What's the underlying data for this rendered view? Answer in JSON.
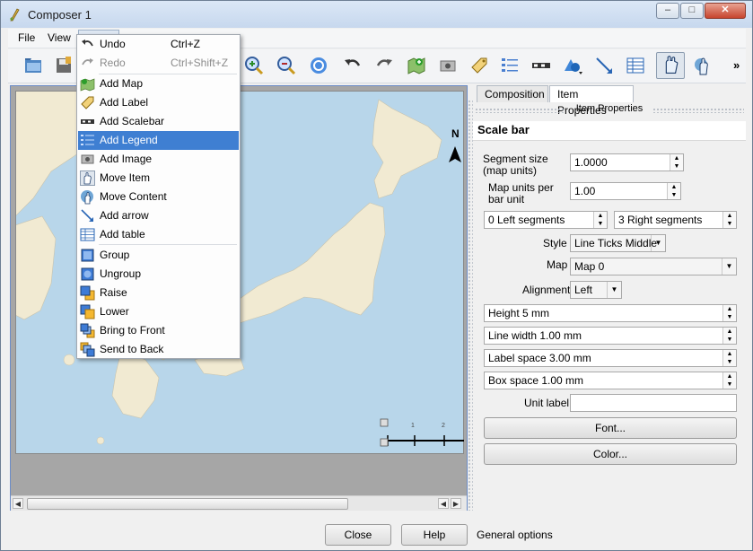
{
  "window": {
    "title": "Composer 1"
  },
  "menubar": {
    "items": [
      "File",
      "View",
      "Edit"
    ]
  },
  "edit_menu": {
    "items": [
      {
        "label": "Undo",
        "shortcut": "Ctrl+Z",
        "icon": "undo-icon",
        "disabled": false
      },
      {
        "label": "Redo",
        "shortcut": "Ctrl+Shift+Z",
        "icon": "redo-icon",
        "disabled": true
      },
      {
        "label": "Add Map",
        "shortcut": "",
        "icon": "add-map-icon",
        "disabled": false
      },
      {
        "label": "Add Label",
        "shortcut": "",
        "icon": "add-label-icon",
        "disabled": false
      },
      {
        "label": "Add Scalebar",
        "shortcut": "",
        "icon": "add-scalebar-icon",
        "disabled": false
      },
      {
        "label": "Add Legend",
        "shortcut": "",
        "icon": "add-legend-icon",
        "disabled": false,
        "highlighted": true
      },
      {
        "label": "Add Image",
        "shortcut": "",
        "icon": "add-image-icon",
        "disabled": false
      },
      {
        "label": "Move Item",
        "shortcut": "",
        "icon": "move-item-icon",
        "disabled": false
      },
      {
        "label": "Move Content",
        "shortcut": "",
        "icon": "move-content-icon",
        "disabled": false
      },
      {
        "label": "Add arrow",
        "shortcut": "",
        "icon": "add-arrow-icon",
        "disabled": false
      },
      {
        "label": "Add table",
        "shortcut": "",
        "icon": "add-table-icon",
        "disabled": false
      },
      {
        "label": "Group",
        "shortcut": "",
        "icon": "group-icon",
        "disabled": false
      },
      {
        "label": "Ungroup",
        "shortcut": "",
        "icon": "ungroup-icon",
        "disabled": false
      },
      {
        "label": "Raise",
        "shortcut": "",
        "icon": "raise-icon",
        "disabled": false
      },
      {
        "label": "Lower",
        "shortcut": "",
        "icon": "lower-icon",
        "disabled": false
      },
      {
        "label": "Bring to Front",
        "shortcut": "",
        "icon": "bring-to-front-icon",
        "disabled": false
      },
      {
        "label": "Send to Back",
        "shortcut": "",
        "icon": "send-to-back-icon",
        "disabled": false
      }
    ]
  },
  "panel": {
    "tabs": [
      "Composition",
      "Item Properties"
    ],
    "active_tab": "Item Properties",
    "subheader": "Item Properties",
    "section_title": "Scale bar",
    "segment_size_label": "Segment size (map units)",
    "segment_size_value": "1.0000",
    "map_units_label": "Map units per bar unit",
    "map_units_value": "1.00",
    "left_segments": "0 Left segments",
    "right_segments": "3 Right segments",
    "style_label": "Style",
    "style_value": "Line Ticks Middle",
    "map_label": "Map",
    "map_value": "Map 0",
    "alignment_label": "Alignment",
    "alignment_value": "Left",
    "height": "Height 5 mm",
    "line_width": "Line width 1.00 mm",
    "label_space": "Label space 3.00 mm",
    "box_space": "Box space 1.00 mm",
    "unit_label_label": "Unit label",
    "unit_label_value": "",
    "font_button": "Font...",
    "color_button": "Color..."
  },
  "bottom": {
    "close": "Close",
    "help": "Help",
    "status": "General options"
  },
  "map": {
    "north_label": "N",
    "scalebar_ticks": [
      "1",
      "2"
    ]
  },
  "colors": {
    "sea": "#b8d6ea",
    "land": "#f1ead2",
    "highlight": "#3f7fd2"
  }
}
